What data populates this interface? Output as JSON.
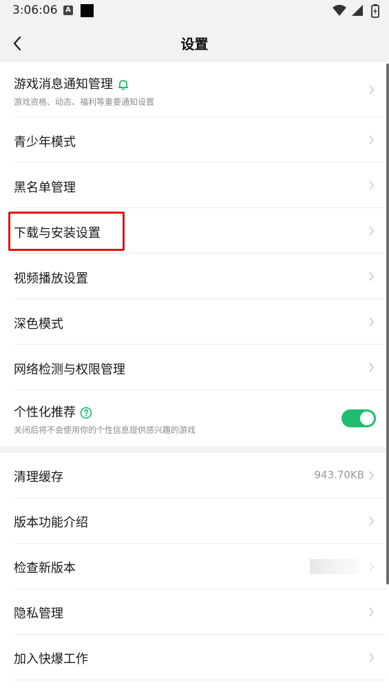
{
  "status_bar": {
    "time": "3:06:06",
    "notification_icon_letter": "A",
    "icons": [
      "wifi-icon",
      "signal-icon",
      "battery-icon"
    ]
  },
  "nav": {
    "back_icon": "chevron-left-icon",
    "title": "设置"
  },
  "colors": {
    "accent_green": "#1fbd6e",
    "highlight_red": "#e01414",
    "background": "#f2f2f2"
  },
  "settings_group_1": [
    {
      "title": "游戏消息通知管理",
      "subtitle": "游戏资格、动态、福利等重要通知设置",
      "icon": "bell-icon"
    },
    {
      "title": "青少年模式"
    },
    {
      "title": "黑名单管理"
    },
    {
      "title": "下载与安装设置"
    },
    {
      "title": "视频播放设置"
    },
    {
      "title": "深色模式"
    },
    {
      "title": "网络检测与权限管理"
    },
    {
      "title": "个性化推荐",
      "subtitle": "关闭后将不会使用你的个性信息提供感兴趣的游戏",
      "icon": "help-circle-icon",
      "toggle_on": true
    }
  ],
  "settings_group_2": [
    {
      "title": "清理缓存",
      "value": "943.70KB"
    },
    {
      "title": "版本功能介绍"
    },
    {
      "title": "检查新版本"
    },
    {
      "title": "隐私管理"
    },
    {
      "title": "加入快爆工作"
    }
  ]
}
